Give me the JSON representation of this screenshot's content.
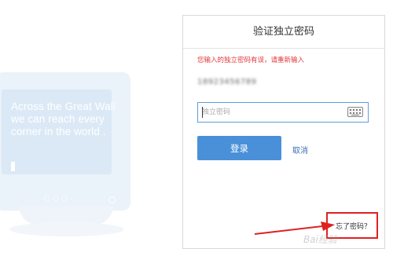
{
  "background": {
    "monitor_text": "Across the Great Wall we can reach every corner in the world ."
  },
  "dialog": {
    "title": "验证独立密码",
    "error_message": "您输入的独立密码有误，请重新输入",
    "account_name": "18923456789",
    "password": {
      "placeholder": "独立密码",
      "value": ""
    },
    "login_label": "登录",
    "cancel_label": "取消",
    "forgot_label": "忘了密码？"
  },
  "annotation": {
    "highlight_color": "#e02020",
    "watermark": "Bai经验"
  },
  "colors": {
    "primary": "#4a90d9",
    "error": "#e5383b",
    "link": "#3a6fb5"
  }
}
